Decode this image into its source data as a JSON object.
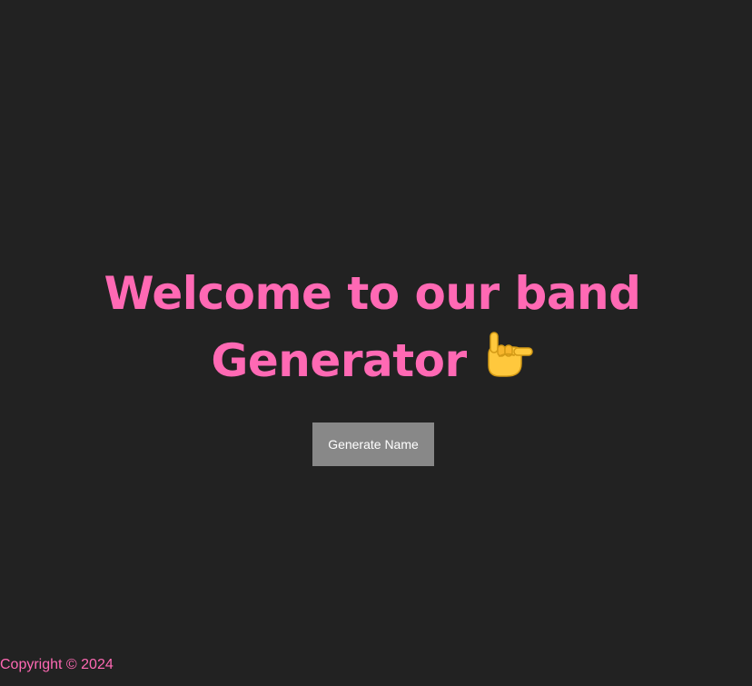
{
  "page": {
    "title_line1": "Welcome to our band",
    "title_line2": "Generator",
    "title_icon": "sign-of-the-horns-icon",
    "generate_button_label": "Generate Name",
    "footer_text": "Copyright © 2024"
  },
  "colors": {
    "background": "#222222",
    "accent": "#ff69b4",
    "button_background": "#888888",
    "button_text": "#ffffff"
  }
}
